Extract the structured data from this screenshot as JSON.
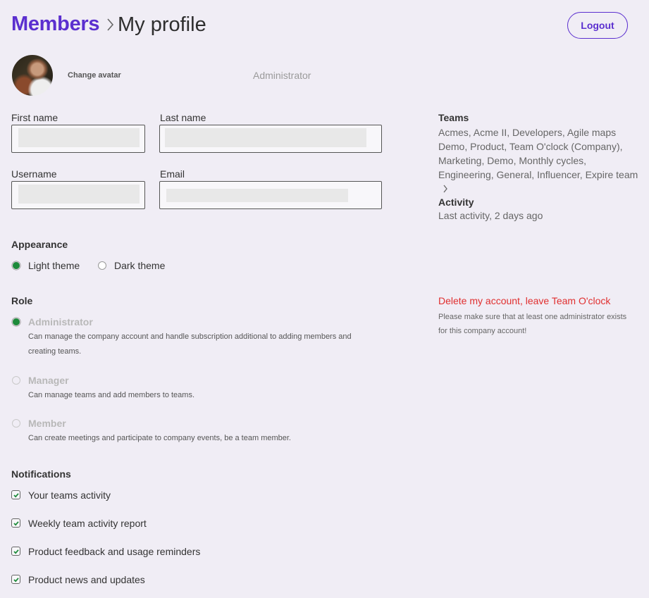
{
  "header": {
    "breadcrumb_root": "Members",
    "breadcrumb_current": "My profile",
    "logout_label": "Logout"
  },
  "profile": {
    "change_avatar_label": "Change avatar",
    "role_display": "Administrator"
  },
  "form": {
    "first_name": {
      "label": "First name",
      "value": ""
    },
    "last_name": {
      "label": "Last name",
      "value": ""
    },
    "username": {
      "label": "Username",
      "value": ""
    },
    "email": {
      "label": "Email",
      "value": ""
    }
  },
  "teams": {
    "heading": "Teams",
    "list": "Acmes, Acme II, Developers, Agile maps Demo, Product, Team O'clock (Company), Marketing, Demo, Monthly cycles, Engineering, General, Influencer, Expire team"
  },
  "activity": {
    "heading": "Activity",
    "text": "Last activity, 2 days ago"
  },
  "danger": {
    "delete_label": "Delete my account, leave Team O'clock",
    "note": "Please make sure that at least one administrator exists for this company account!"
  },
  "appearance": {
    "heading": "Appearance",
    "options": [
      {
        "label": "Light theme",
        "checked": true
      },
      {
        "label": "Dark theme",
        "checked": false
      }
    ]
  },
  "role": {
    "heading": "Role",
    "options": [
      {
        "name": "Administrator",
        "description": "Can manage the company account and handle subscription additional to adding members and creating teams.",
        "checked": true
      },
      {
        "name": "Manager",
        "description": "Can manage teams and add members to teams.",
        "checked": false
      },
      {
        "name": "Member",
        "description": "Can create meetings and participate to company events, be a team member.",
        "checked": false
      }
    ]
  },
  "notifications": {
    "heading": "Notifications",
    "items": [
      {
        "label": "Your teams activity",
        "checked": true
      },
      {
        "label": "Weekly team activity report",
        "checked": true
      },
      {
        "label": "Product feedback and usage reminders",
        "checked": true
      },
      {
        "label": "Product news and updates",
        "checked": true
      }
    ]
  },
  "colors": {
    "brand": "#5b2fcf",
    "success": "#1c8a3a",
    "danger": "#e02f2f",
    "background": "#f0edf5"
  }
}
